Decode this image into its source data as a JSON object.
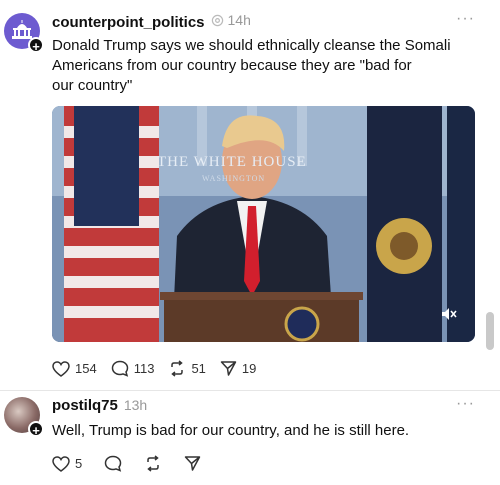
{
  "posts": [
    {
      "username": "counterpoint_politics",
      "time": "14h",
      "text_lines": [
        "Donald Trump says we should ethnically cleanse the Somali",
        "Americans from our country because they are \"bad for",
        "our country\""
      ],
      "video_podium_sign": "THE WHITE HOUSE",
      "video_podium_sub": "WASHINGTON",
      "stats": {
        "likes": "154",
        "comments": "113",
        "reposts": "51",
        "shares": "19"
      }
    },
    {
      "username": "postilq75",
      "time": "13h",
      "text": "Well, Trump is bad for our country, and he is still here.",
      "stats": {
        "likes": "5"
      }
    }
  ],
  "icons": {
    "avatar1": "capitol-icon",
    "badge": "plus-icon",
    "more": "more-icon",
    "like": "heart-icon",
    "comment": "comment-icon",
    "repost": "repost-icon",
    "share": "share-icon",
    "mute": "mute-icon"
  },
  "colors": {
    "accent": "#6d5bd0",
    "text": "#101010",
    "muted": "#999999"
  }
}
